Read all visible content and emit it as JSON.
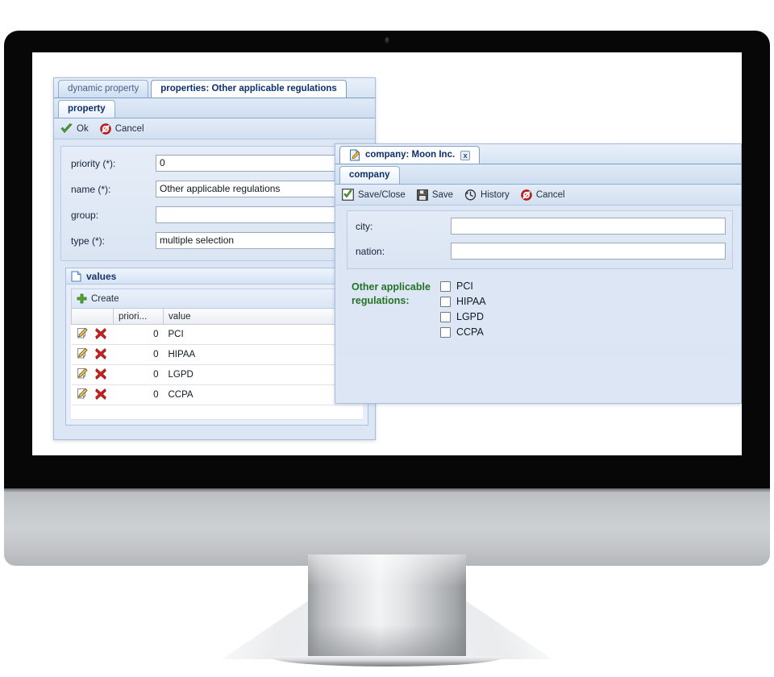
{
  "device": {
    "type": "desktop-monitor",
    "bezel_color": "#070707",
    "chin_color": "#c5c8ca"
  },
  "property_window": {
    "top_tabs": [
      {
        "label": "dynamic property",
        "active": false
      },
      {
        "label": "properties: Other applicable regulations",
        "active": true
      }
    ],
    "sub_tabs": [
      {
        "label": "property",
        "active": true
      }
    ],
    "toolbar": [
      {
        "label": "Ok",
        "icon": "green-check-icon"
      },
      {
        "label": "Cancel",
        "icon": "red-cancel-icon"
      }
    ],
    "fields": [
      {
        "label": "priority (*):",
        "value": "0"
      },
      {
        "label": "name (*):",
        "value": "Other applicable regulations"
      },
      {
        "label": "group:",
        "value": ""
      },
      {
        "label": "type (*):",
        "value": "multiple selection"
      }
    ],
    "values_box": {
      "title": "values",
      "title_icon": "page-icon",
      "create_label": "Create",
      "create_icon": "green-plus-icon",
      "columns": [
        "",
        "priori...",
        "value"
      ],
      "rows": [
        {
          "priority": "0",
          "value": "PCI"
        },
        {
          "priority": "0",
          "value": "HIPAA"
        },
        {
          "priority": "0",
          "value": "LGPD"
        },
        {
          "priority": "0",
          "value": "CCPA"
        }
      ],
      "row_icons": [
        "edit-pencil-icon",
        "delete-x-icon"
      ]
    }
  },
  "company_window": {
    "title": "company: Moon Inc.",
    "title_icon": "document-edit-icon",
    "close_label": "x",
    "sub_tabs": [
      {
        "label": "company",
        "active": true
      }
    ],
    "toolbar": [
      {
        "label": "Save/Close",
        "icon": "save-close-icon"
      },
      {
        "label": "Save",
        "icon": "floppy-disk-icon"
      },
      {
        "label": "History",
        "icon": "clock-history-icon"
      },
      {
        "label": "Cancel",
        "icon": "red-cancel-icon"
      }
    ],
    "fields": [
      {
        "label": "city:",
        "value": ""
      },
      {
        "label": "nation:",
        "value": ""
      }
    ],
    "multi_select": {
      "label": "Other applicable regulations:",
      "label_color": "#257225",
      "options": [
        {
          "label": "PCI",
          "checked": false
        },
        {
          "label": "HIPAA",
          "checked": false
        },
        {
          "label": "LGPD",
          "checked": false
        },
        {
          "label": "CCPA",
          "checked": false
        }
      ]
    }
  }
}
